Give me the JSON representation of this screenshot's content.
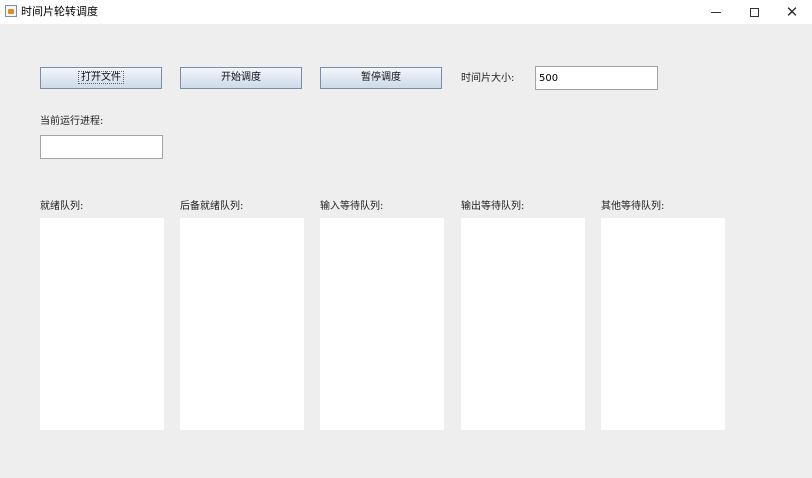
{
  "window": {
    "title": "时间片轮转调度"
  },
  "toolbar": {
    "open_file_label": "打开文件",
    "start_label": "开始调度",
    "pause_label": "暂停调度",
    "time_slice_label": "时间片大小:",
    "time_slice_value": "500"
  },
  "current_process": {
    "label": "当前运行进程:",
    "value": ""
  },
  "queues": [
    {
      "label": "就绪队列:",
      "items": []
    },
    {
      "label": "后备就绪队列:",
      "items": []
    },
    {
      "label": "输入等待队列:",
      "items": []
    },
    {
      "label": "输出等待队列:",
      "items": []
    },
    {
      "label": "其他等待队列:",
      "items": []
    }
  ],
  "icons": {
    "app": "java-app-icon",
    "minimize": "minimize-icon",
    "maximize": "maximize-icon",
    "close": "close-icon"
  }
}
